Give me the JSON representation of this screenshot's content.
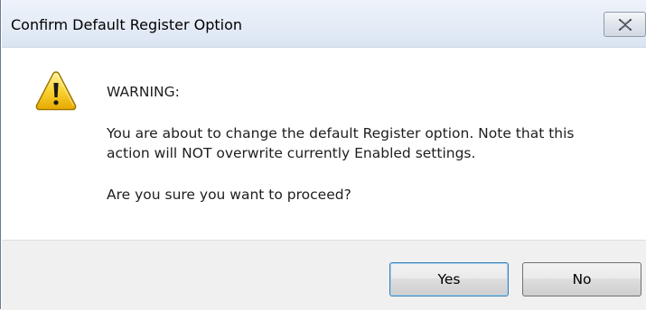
{
  "window": {
    "title": "Confirm Default Register Option"
  },
  "icons": {
    "close": "close-icon",
    "warning": "warning-icon"
  },
  "colors": {
    "warning_fill": "#f5c518",
    "warning_outline": "#9a7200",
    "default_button_border": "#3c7fb1"
  },
  "message": {
    "heading": "WARNING:",
    "line1": "You are about to change the default Register option. Note that this",
    "line2": "action will NOT overwrite currently Enabled settings.",
    "question": "Are you sure you want to proceed?"
  },
  "buttons": {
    "yes_label": "Yes",
    "no_label": "No",
    "default": "Yes"
  }
}
